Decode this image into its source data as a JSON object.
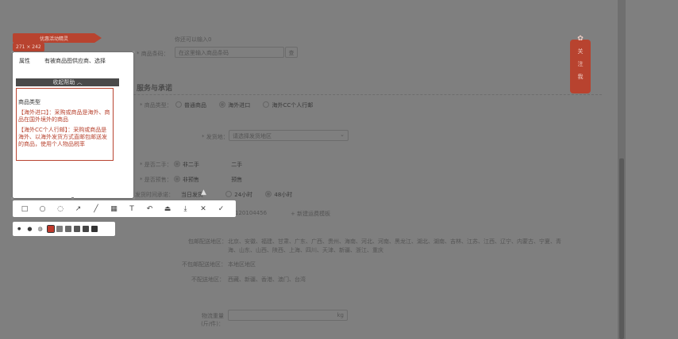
{
  "top_hint": "你还可以输入0",
  "reference_field": {
    "label": "* 商品条码：",
    "value": "在这里输入商品条码",
    "button": "查"
  },
  "section_title": "服务与承诺",
  "product_type": {
    "label": "* 商品类型：",
    "options": [
      "普通商品",
      "海外进口",
      "海外CC个人行邮"
    ],
    "selected": 1
  },
  "origin": {
    "label": "* 发货地：",
    "placeholder": "请选择发货地区"
  },
  "stock_a": {
    "label": "* 是否二手：",
    "options": [
      "非二手",
      "二手"
    ],
    "selected": 0
  },
  "stock_b": {
    "label": "* 是否预售：",
    "options": [
      "非预售",
      "预售"
    ],
    "selected": 0
  },
  "delivery": {
    "label": "发货时间承诺：",
    "options": [
      "当日发货",
      "24小时",
      "48小时"
    ],
    "selected": 2
  },
  "template_row": {
    "code": "120104456",
    "link": "新建运费模板"
  },
  "shipping_areas": [
    {
      "label": "包邮配送地区：",
      "value": "北京、安徽、福建、甘肃、广东、广西、贵州、海南、河北、河南、黑龙江、湖北、湖南、吉林、江苏、江西、辽宁、内蒙古、宁夏、青海、山东、山西、陕西、上海、四川、天津、新疆、浙江、重庆"
    },
    {
      "label": "不包邮配送地区：",
      "value": "本地区地区"
    },
    {
      "label": "不配送地区：",
      "value": "西藏、新疆、香港、澳门、台湾"
    }
  ],
  "weight_field": {
    "label": "物流重量(斤/件)：",
    "unit": "kg"
  },
  "capture": {
    "size_badge": "271 × 242",
    "tag_badge": "优惠活动精灵",
    "row1_label": "属性",
    "row1_text": "有被商品图供应商、选择",
    "expand_btn": "收起帮助",
    "help_title": "商品类型",
    "help_p1": "【海外进口】：采购或商品是海外、商品在国外境外的商品",
    "help_p2": "【海外CC个人行邮】：采购或商品是海外、以海外发货方式直邮包邮送发的商品，使用个人物品税率"
  },
  "toolbar_icons": [
    "rect-tool",
    "ellipse-tool",
    "lasso-tool",
    "arrow-tool",
    "pen-tool",
    "mosaic-tool",
    "text-tool",
    "undo-tool",
    "pin-tool",
    "download-tool",
    "cancel-tool",
    "confirm-tool"
  ],
  "subbar": {
    "sizes": [
      "small",
      "medium",
      "large"
    ],
    "colors": [
      "#c0392b",
      "#7d7d7d",
      "#6a6a6a",
      "#555555",
      "#444444",
      "#333333"
    ]
  },
  "side_widget": {
    "lines": [
      "关",
      "注",
      "我"
    ]
  },
  "colors": {
    "accent": "#b8432f",
    "overlay": "#7f7f7f"
  }
}
